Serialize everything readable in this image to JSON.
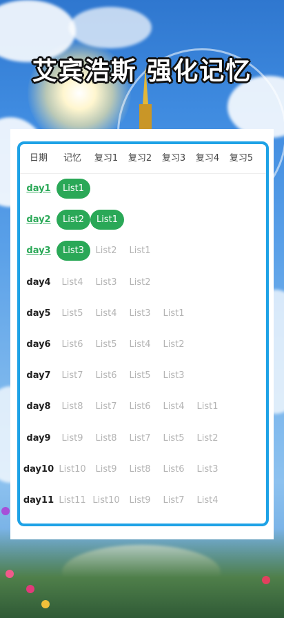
{
  "title": "艾宾浩斯 强化记忆",
  "colors": {
    "accent_green": "#2aa857",
    "frame_blue": "#1ea2e6",
    "inactive_gray": "#b4b4b4"
  },
  "table": {
    "headers": [
      "日期",
      "记忆",
      "复习1",
      "复习2",
      "复习3",
      "复习4",
      "复习5"
    ],
    "rows": [
      {
        "day": "day1",
        "day_done": true,
        "cells": [
          {
            "t": "List1",
            "active": true
          }
        ]
      },
      {
        "day": "day2",
        "day_done": true,
        "cells": [
          {
            "t": "List2",
            "active": true
          },
          {
            "t": "List1",
            "active": true
          }
        ]
      },
      {
        "day": "day3",
        "day_done": true,
        "cells": [
          {
            "t": "List3",
            "active": true
          },
          {
            "t": "List2",
            "active": false
          },
          {
            "t": "List1",
            "active": false
          }
        ]
      },
      {
        "day": "day4",
        "day_done": false,
        "cells": [
          {
            "t": "List4"
          },
          {
            "t": "List3"
          },
          {
            "t": "List2"
          }
        ]
      },
      {
        "day": "day5",
        "day_done": false,
        "cells": [
          {
            "t": "List5"
          },
          {
            "t": "List4"
          },
          {
            "t": "List3"
          },
          {
            "t": "List1"
          }
        ]
      },
      {
        "day": "day6",
        "day_done": false,
        "cells": [
          {
            "t": "List6"
          },
          {
            "t": "List5"
          },
          {
            "t": "List4"
          },
          {
            "t": "List2"
          }
        ]
      },
      {
        "day": "day7",
        "day_done": false,
        "cells": [
          {
            "t": "List7"
          },
          {
            "t": "List6"
          },
          {
            "t": "List5"
          },
          {
            "t": "List3"
          }
        ]
      },
      {
        "day": "day8",
        "day_done": false,
        "cells": [
          {
            "t": "List8"
          },
          {
            "t": "List7"
          },
          {
            "t": "List6"
          },
          {
            "t": "List4"
          },
          {
            "t": "List1"
          }
        ]
      },
      {
        "day": "day9",
        "day_done": false,
        "cells": [
          {
            "t": "List9"
          },
          {
            "t": "List8"
          },
          {
            "t": "List7"
          },
          {
            "t": "List5"
          },
          {
            "t": "List2"
          }
        ]
      },
      {
        "day": "day10",
        "day_done": false,
        "cells": [
          {
            "t": "List10"
          },
          {
            "t": "List9"
          },
          {
            "t": "List8"
          },
          {
            "t": "List6"
          },
          {
            "t": "List3"
          }
        ]
      },
      {
        "day": "day11",
        "day_done": false,
        "cells": [
          {
            "t": "List11"
          },
          {
            "t": "List10"
          },
          {
            "t": "List9"
          },
          {
            "t": "List7"
          },
          {
            "t": "List4"
          }
        ]
      }
    ]
  }
}
